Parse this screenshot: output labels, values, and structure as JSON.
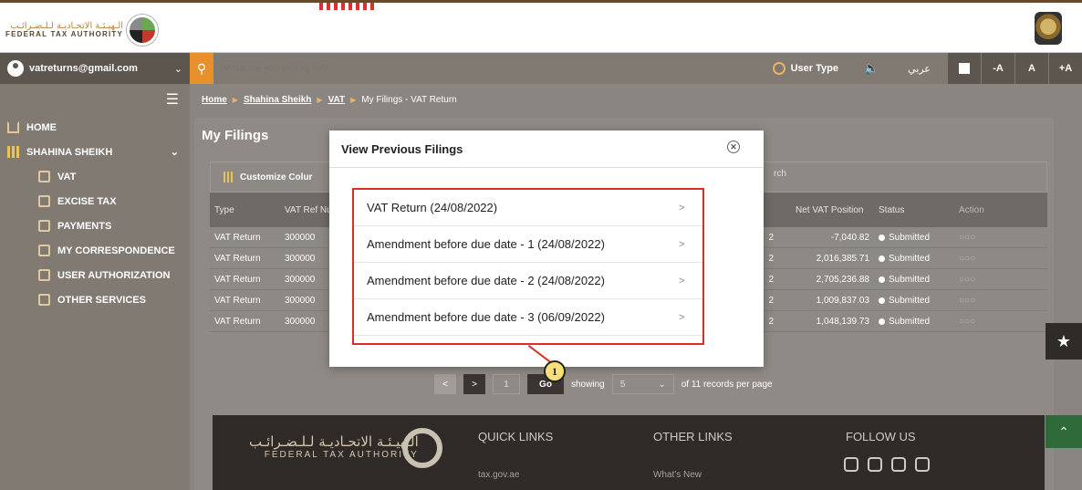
{
  "header": {
    "logo_arabic": "الـهيـئـة الاتحـاديـة لـلـضـرائـب",
    "logo_english": "FEDERAL TAX AUTHORITY"
  },
  "navbar": {
    "account_email": "vatreturns@gmail.com",
    "search_placeholder": "What are you looking for?",
    "user_type_label": "User Type",
    "language_label": "عربي",
    "font_minus": "-A",
    "font_normal": "A",
    "font_plus": "+A"
  },
  "sidebar": {
    "items": [
      {
        "label": "HOME",
        "icon": "home-icon"
      },
      {
        "label": "SHAHINA SHEIKH",
        "icon": "grid-icon"
      },
      {
        "label": "VAT",
        "icon": "vat-icon"
      },
      {
        "label": "EXCISE TAX",
        "icon": "excise-icon"
      },
      {
        "label": "PAYMENTS",
        "icon": "payments-icon"
      },
      {
        "label": "MY CORRESPONDENCE",
        "icon": "correspondence-icon"
      },
      {
        "label": "USER AUTHORIZATION",
        "icon": "user-auth-icon"
      },
      {
        "label": "OTHER SERVICES",
        "icon": "other-services-icon"
      }
    ]
  },
  "breadcrumb": {
    "home": "Home",
    "user": "Shahina Sheikh",
    "vat": "VAT",
    "current": "My Filings - VAT Return"
  },
  "main": {
    "title": "My Filings",
    "customize_label": "Customize Colur",
    "search_label": "rch"
  },
  "table": {
    "headers": {
      "type": "Type",
      "ref": "VAT Ref Number",
      "net": "Net VAT Position",
      "status": "Status",
      "action": "Action"
    },
    "rows": [
      {
        "type": "VAT Return",
        "ref": "300000",
        "mid": "2",
        "net": "-7,040.82",
        "status": "Submitted",
        "action": "○○○"
      },
      {
        "type": "VAT Return",
        "ref": "300000",
        "mid": "2",
        "net": "2,016,385.71",
        "status": "Submitted",
        "action": "○○○"
      },
      {
        "type": "VAT Return",
        "ref": "300000",
        "mid": "2",
        "net": "2,705,236.88",
        "status": "Submitted",
        "action": "○○○"
      },
      {
        "type": "VAT Return",
        "ref": "300000",
        "mid": "2",
        "net": "1,009,837.03",
        "status": "Submitted",
        "action": "○○○"
      },
      {
        "type": "VAT Return",
        "ref": "300000",
        "mid": "2",
        "net": "1,048,139.73",
        "status": "Submitted",
        "action": "○○○"
      }
    ]
  },
  "pager": {
    "prev": "<",
    "next": ">",
    "page": "1",
    "go": "Go",
    "showing": "showing",
    "per_page_value": "5",
    "records_text": "of 11 records per page"
  },
  "footer": {
    "logo_arabic": "الـهيـئـة الاتحـاديـة لـلـضـرائـب",
    "logo_english": "FEDERAL TAX AUTHORITY",
    "quick_links": "QUICK LINKS",
    "other_links": "OTHER LINKS",
    "follow_us": "FOLLOW US",
    "quick_link_1": "tax.gov.ae",
    "other_link_1": "What's New"
  },
  "modal": {
    "title": "View Previous Filings",
    "filings": [
      "VAT Return (24/08/2022)",
      "Amendment before due date - 1 (24/08/2022)",
      "Amendment before due date - 2 (24/08/2022)",
      "Amendment before due date - 3 (06/09/2022)"
    ],
    "callout_number": "1"
  },
  "colors": {
    "highlight": "#e52a2a",
    "accent": "#e8912b",
    "callout_fill": "#f7e07a"
  }
}
